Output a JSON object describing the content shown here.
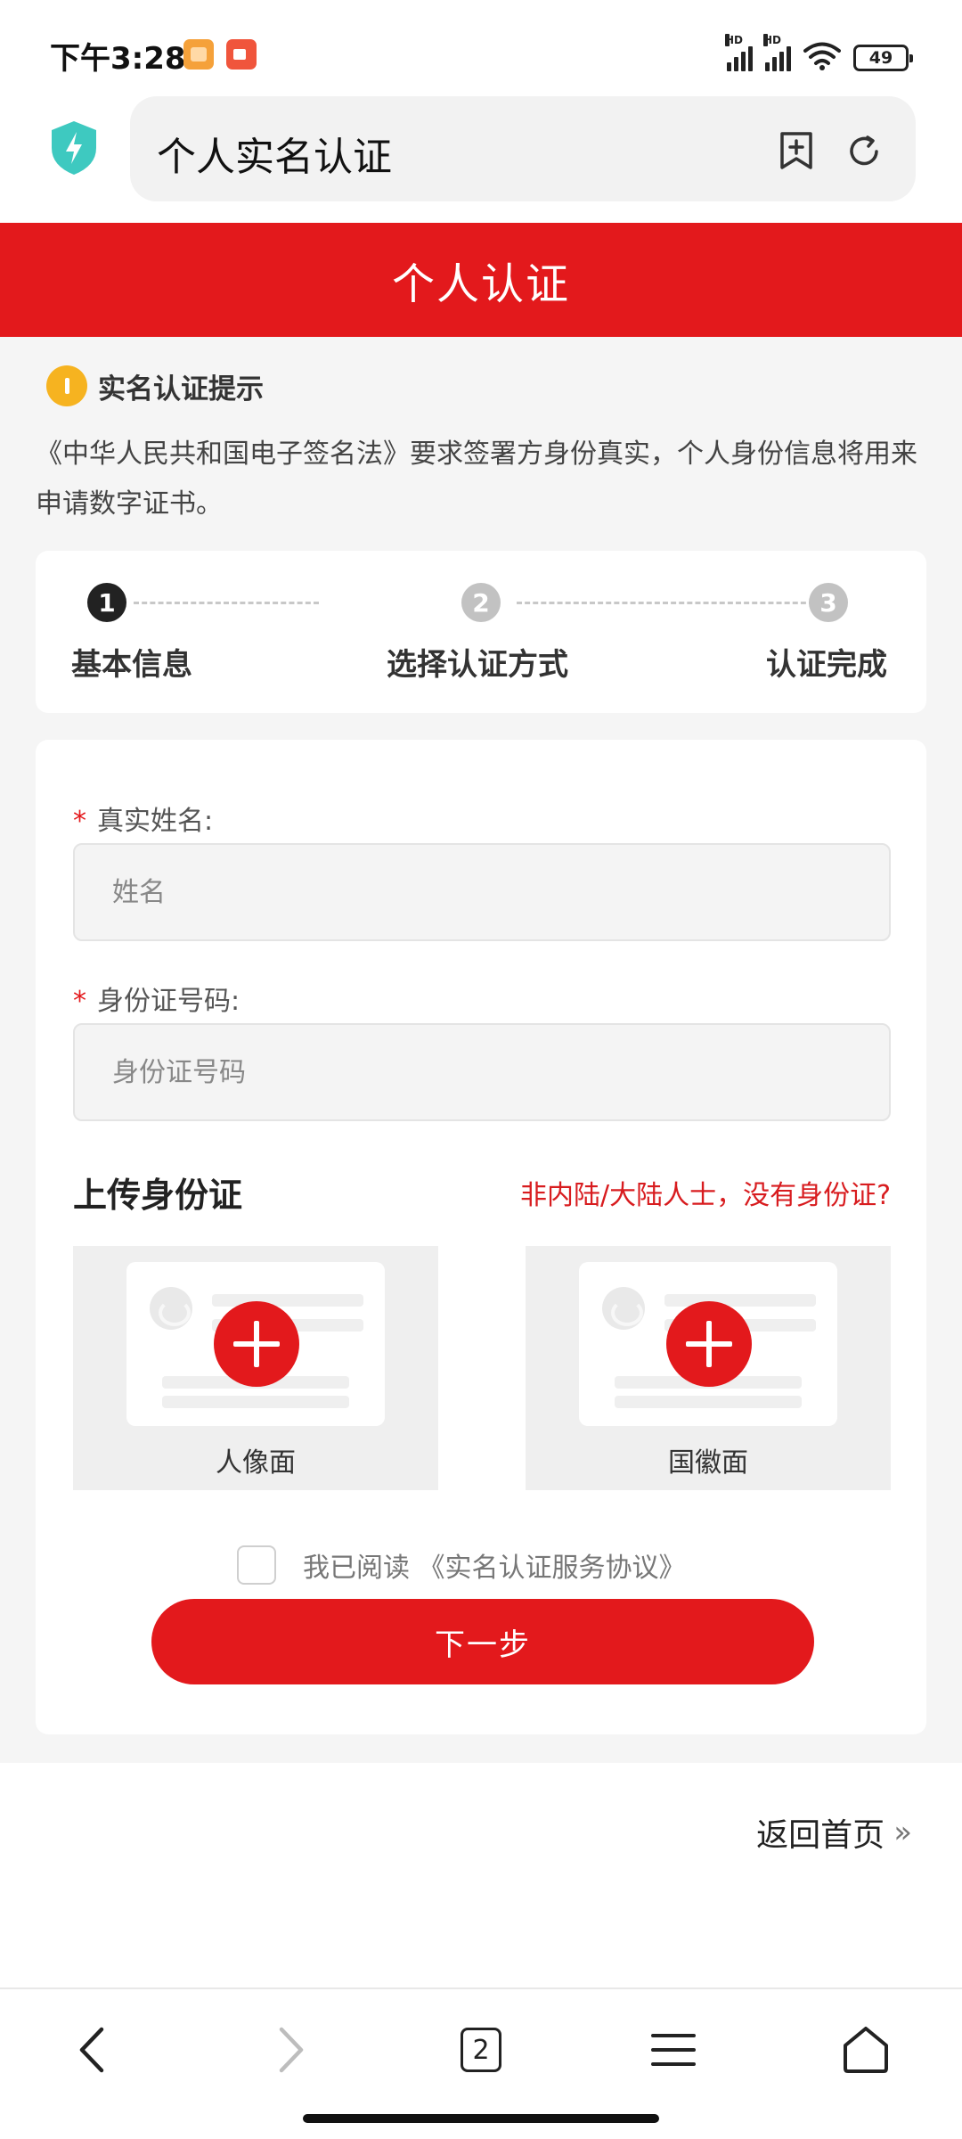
{
  "status_bar": {
    "time": "下午3:28",
    "battery": "49"
  },
  "browser": {
    "url_title": "个人实名认证"
  },
  "page": {
    "header_title": "个人认证",
    "notice_title": "实名认证提示",
    "notice_text": "《中华人民共和国电子签名法》要求签署方身份真实，个人身份信息将用来申请数字证书。"
  },
  "steps": [
    {
      "num": "1",
      "label": "基本信息",
      "active": true
    },
    {
      "num": "2",
      "label": "选择认证方式",
      "active": false
    },
    {
      "num": "3",
      "label": "认证完成",
      "active": false
    }
  ],
  "form": {
    "required_mark": "*",
    "name_label": "真实姓名:",
    "name_placeholder": "姓名",
    "name_value": "",
    "id_label": "身份证号码:",
    "id_placeholder": "身份证号码",
    "id_value": "",
    "upload_title": "上传身份证",
    "upload_link": "非内陆/大陆人士，没有身份证?",
    "upload_front_caption": "人像面",
    "upload_back_caption": "国徽面",
    "agree_text": "我已阅读 《实名认证服务协议》",
    "agree_checked": false,
    "next_button": "下一步"
  },
  "footer": {
    "back_home": "返回首页",
    "back_home_chevron": "»"
  },
  "bottom_nav": {
    "tabs_count": "2"
  },
  "colors": {
    "brand_red": "#e3191c",
    "notice_yellow": "#f6b320",
    "shield_teal": "#3ec9c0"
  }
}
